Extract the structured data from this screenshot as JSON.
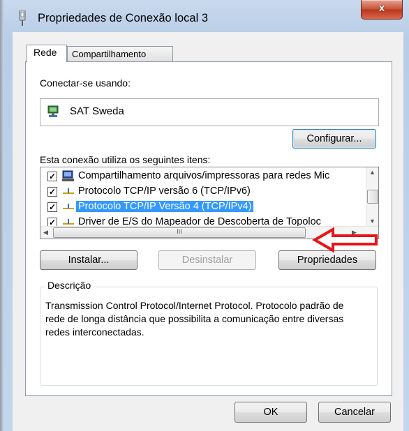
{
  "window": {
    "title": "Propriedades de Conexão local 3",
    "close_label": "x"
  },
  "tabs": [
    {
      "label": "Rede"
    },
    {
      "label": "Compartilhamento"
    }
  ],
  "connect_using": {
    "label": "Conectar-se usando:",
    "adapter": "SAT Sweda",
    "configure_button": "Configurar..."
  },
  "items": {
    "label": "Esta conexão utiliza os seguintes itens:",
    "list": [
      {
        "text": "Compartilhamento arquivos/impressoras para redes Mic",
        "checked": true,
        "icon": "network-service-icon"
      },
      {
        "text": "Protocolo TCP/IP versão 6 (TCP/IPv6)",
        "checked": true,
        "icon": "protocol-icon"
      },
      {
        "text": "Protocolo TCP/IP Versão 4 (TCP/IPv4)",
        "checked": true,
        "icon": "protocol-icon",
        "selected": true
      },
      {
        "text": "Driver de E/S do Mapeador de Descoberta de Topoloc",
        "checked": true,
        "icon": "protocol-icon"
      }
    ],
    "hscroll_thumb": "III"
  },
  "buttons": {
    "install": "Instalar...",
    "uninstall": "Desinstalar",
    "properties": "Propriedades",
    "ok": "OK",
    "cancel": "Cancelar"
  },
  "description": {
    "legend": "Descrição",
    "text": "Transmission Control Protocol/Internet Protocol. Protocolo padrão de rede de longa distância que possibilita a comunicação entre diversas redes interconectadas."
  },
  "colors": {
    "selection": "#3399ff",
    "annotation_arrow": "#e8141b"
  }
}
